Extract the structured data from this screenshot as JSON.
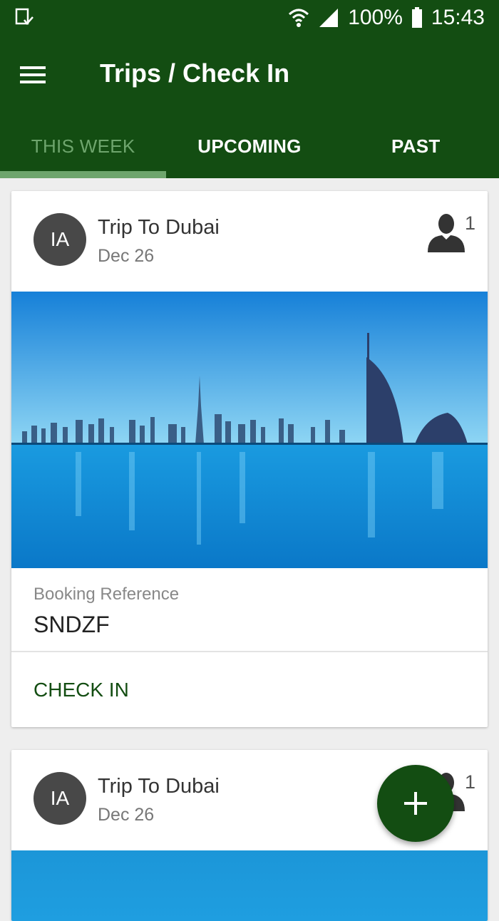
{
  "status_bar": {
    "battery": "100%",
    "time": "15:43",
    "icons": [
      "download-notification-icon",
      "wifi-icon",
      "signal-icon",
      "battery-icon"
    ]
  },
  "toolbar": {
    "title": "Trips / Check In",
    "menu_icon": "hamburger-menu-icon"
  },
  "tabs": [
    {
      "label": "THIS WEEK",
      "active": true
    },
    {
      "label": "UPCOMING",
      "active": false
    },
    {
      "label": "PAST",
      "active": false
    }
  ],
  "trips": [
    {
      "avatar_initials": "IA",
      "title": "Trip To Dubai",
      "date": "Dec 26",
      "travellers": "1",
      "booking_label": "Booking Reference",
      "booking_ref": "SNDZF",
      "action": "CHECK IN"
    },
    {
      "avatar_initials": "IA",
      "title": "Trip To Dubai",
      "date": "Dec 26",
      "travellers": "1"
    }
  ],
  "fab": {
    "icon": "plus-icon"
  },
  "colors": {
    "primary": "#134d12",
    "tab_active": "#6ea56d",
    "avatar": "#484848"
  }
}
